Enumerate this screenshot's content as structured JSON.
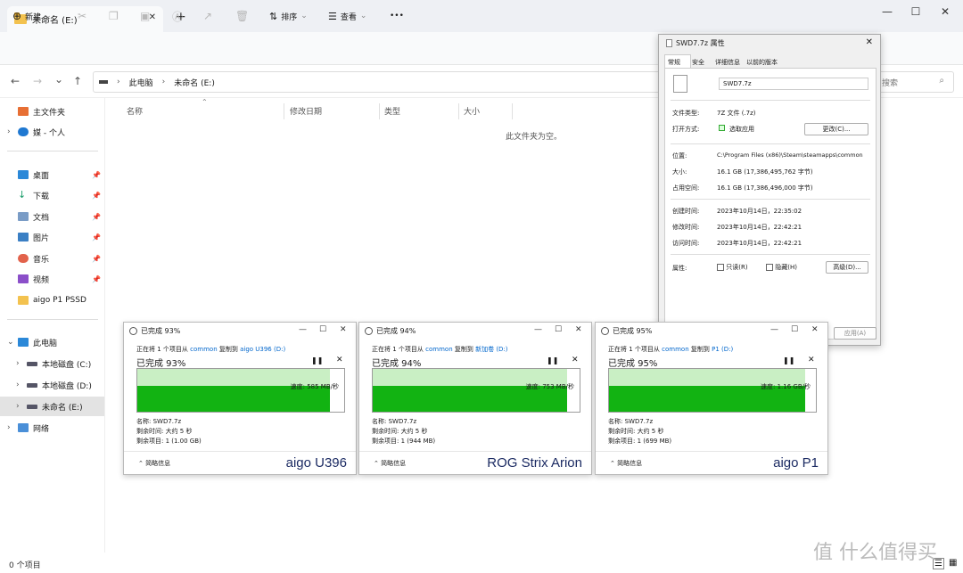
{
  "window": {
    "tab_title": "未命名 (E:)",
    "tab_close": "✕",
    "new_tab": "+",
    "controls": {
      "minimize": "—",
      "maximize": "☐",
      "close": "✕"
    }
  },
  "toolbar": {
    "new_label": "新建",
    "sort_label": "排序",
    "view_label": "查看",
    "more": "•••"
  },
  "address": {
    "back": "←",
    "forward": "→",
    "down": "⌄",
    "up": "↑",
    "crumbs": [
      "此电脑",
      "未命名 (E:)"
    ],
    "search_placeholder": "搜索"
  },
  "sidebar": {
    "items": [
      {
        "label": "主文件夹"
      },
      {
        "label": "媒 - 个人"
      },
      {
        "label": "桌面"
      },
      {
        "label": "下载"
      },
      {
        "label": "文档"
      },
      {
        "label": "图片"
      },
      {
        "label": "音乐"
      },
      {
        "label": "视频"
      },
      {
        "label": "aigo P1 PSSD"
      },
      {
        "label": "此电脑"
      },
      {
        "label": "本地磁盘 (C:)"
      },
      {
        "label": "本地磁盘 (D:)"
      },
      {
        "label": "未命名 (E:)"
      },
      {
        "label": "网络"
      }
    ]
  },
  "content": {
    "columns": [
      "名称",
      "修改日期",
      "类型",
      "大小"
    ],
    "empty_text": "此文件夹为空。"
  },
  "status": {
    "text": "0 个项目"
  },
  "properties": {
    "title": "SWD7.7z 属性",
    "tabs": [
      "常规",
      "安全",
      "详细信息",
      "以前的版本"
    ],
    "filename": "SWD7.7z",
    "rows": {
      "type_label": "文件类型:",
      "type_value": "7Z 文件 (.7z)",
      "open_label": "打开方式:",
      "open_value": "选取应用",
      "change_btn": "更改(C)...",
      "loc_label": "位置:",
      "loc_value": "C:\\Program Files (x86)\\Steam\\steamapps\\common",
      "size_label": "大小:",
      "size_value": "16.1 GB (17,386,495,762 字节)",
      "disk_label": "占用空间:",
      "disk_value": "16.1 GB (17,386,496,000 字节)",
      "created_label": "创建时间:",
      "created_value": "2023年10月14日，22:35:02",
      "modified_label": "修改时间:",
      "modified_value": "2023年10月14日，22:42:21",
      "accessed_label": "访问时间:",
      "accessed_value": "2023年10月14日，22:42:21",
      "attr_label": "属性:",
      "readonly": "只读(R)",
      "hidden": "隐藏(H)",
      "advanced_btn": "高级(D)...",
      "apply_btn": "应用(A)"
    }
  },
  "copies": [
    {
      "title": "已完成 93%",
      "line_pre": "正在将 1 个项目从 ",
      "src": "common",
      "line_mid": " 复制到 ",
      "dst": "aigo U396 (D:)",
      "pct_text": "已完成 93%",
      "progress": 0.93,
      "speed": "速度: 585 MB/秒",
      "name": "名称: SWD7.7z",
      "remain_time": "剩余时间: 大约 5 秒",
      "remain_items": "剩余项目: 1 (1.00 GB)",
      "less": "简略信息",
      "brand": "aigo U396"
    },
    {
      "title": "已完成 94%",
      "line_pre": "正在将 1 个项目从 ",
      "src": "common",
      "line_mid": " 复制到 ",
      "dst": "新加卷 (D:)",
      "pct_text": "已完成 94%",
      "progress": 0.94,
      "speed": "速度: 753 MB/秒",
      "name": "名称: SWD7.7z",
      "remain_time": "剩余时间: 大约 5 秒",
      "remain_items": "剩余项目: 1 (944 MB)",
      "less": "简略信息",
      "brand": "ROG Strix Arion"
    },
    {
      "title": "已完成 95%",
      "line_pre": "正在将 1 个项目从 ",
      "src": "common",
      "line_mid": " 复制到 ",
      "dst": "P1 (D:)",
      "pct_text": "已完成 95%",
      "progress": 0.95,
      "speed": "速度: 1.16 GB/秒",
      "name": "名称: SWD7.7z",
      "remain_time": "剩余时间: 大约 5 秒",
      "remain_items": "剩余项目: 1 (699 MB)",
      "less": "简略信息",
      "brand": "aigo P1"
    }
  ],
  "watermark": "值 什么值得买"
}
